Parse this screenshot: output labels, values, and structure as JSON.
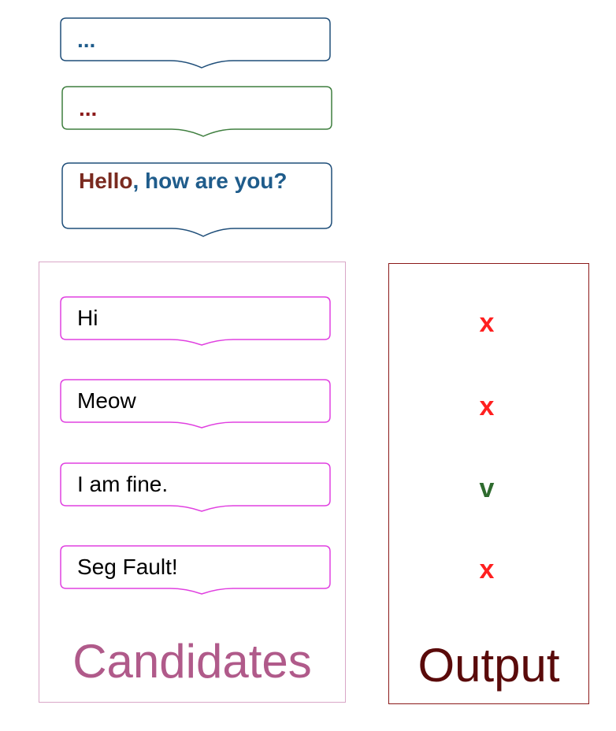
{
  "context": [
    {
      "segments": [
        {
          "text": "...",
          "color": "#1f5c8b"
        }
      ],
      "border": "#1f4e79"
    },
    {
      "segments": [
        {
          "text": "...",
          "color": "#8b1a1a"
        }
      ],
      "border": "#3f7f3f"
    },
    {
      "segments": [
        {
          "text": "Hello",
          "color": "#7a2a1f"
        },
        {
          "text": ", ",
          "color": "#1f5c8b"
        },
        {
          "text": "how are you?",
          "color": "#1f5c8b"
        }
      ],
      "border": "#1f4e79"
    }
  ],
  "candidates": {
    "title": "Candidates",
    "title_color": "#b05a8a",
    "border_color": "#d9a7c7",
    "bubble_color": "#e040e0",
    "items": [
      {
        "text": "Hi",
        "mark": "x",
        "mark_color": "#ff2020"
      },
      {
        "text": "Meow",
        "mark": "x",
        "mark_color": "#ff2020"
      },
      {
        "text": "I am fine.",
        "mark": "v",
        "mark_color": "#2e6b2e"
      },
      {
        "text": "Seg Fault!",
        "mark": "x",
        "mark_color": "#ff2020"
      }
    ]
  },
  "output": {
    "title": "Output",
    "title_color": "#5a0a0a",
    "border_color": "#8b1a1a"
  }
}
